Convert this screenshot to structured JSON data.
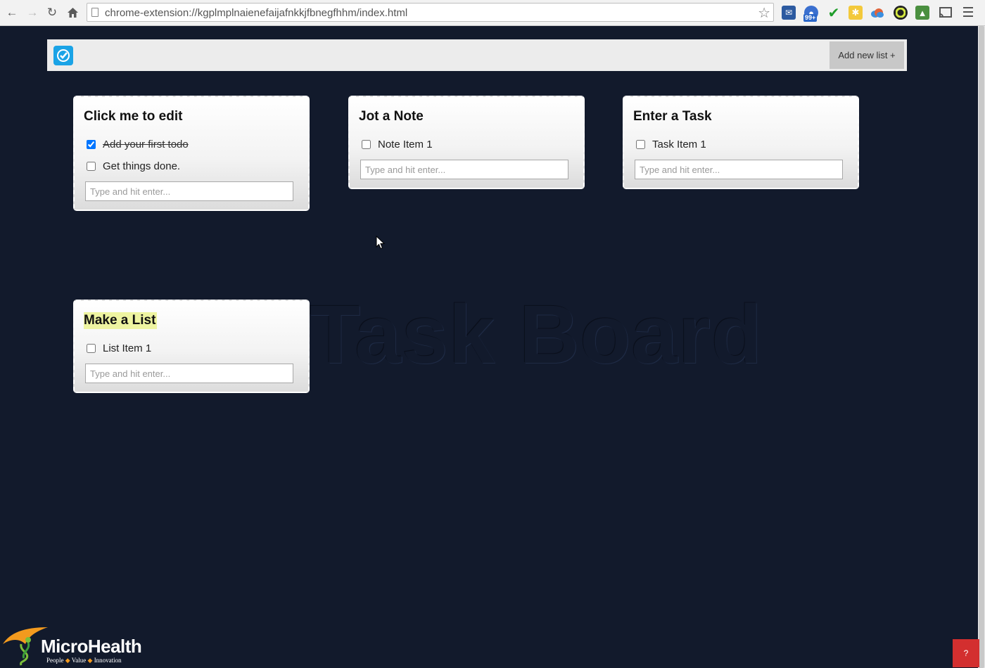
{
  "browser": {
    "url": "chrome-extension://kgplmplnaienefaijafnkkjfbnegfhhm/index.html",
    "extension_badge": "99+"
  },
  "header": {
    "add_list_label": "Add new list +"
  },
  "watermark": "Task Board",
  "lists": [
    {
      "title": "Click me to edit",
      "items": [
        {
          "label": "Add your first todo",
          "checked": true
        },
        {
          "label": "Get things done.",
          "checked": false
        }
      ],
      "input_placeholder": "Type and hit enter..."
    },
    {
      "title": "Jot a Note",
      "items": [
        {
          "label": "Note Item 1",
          "checked": false
        }
      ],
      "input_placeholder": "Type and hit enter..."
    },
    {
      "title": "Enter a Task",
      "items": [
        {
          "label": "Task Item 1",
          "checked": false
        }
      ],
      "input_placeholder": "Type and hit enter..."
    },
    {
      "title": "Make a List",
      "items": [
        {
          "label": "List Item 1",
          "checked": false
        }
      ],
      "input_placeholder": "Type and hit enter..."
    }
  ],
  "footer": {
    "brand_name": "MicroHealth",
    "tagline": [
      "People",
      "Value",
      "Innovation"
    ],
    "help_label": "?"
  },
  "colors": {
    "background": "#121a2c",
    "logo_blue": "#1aa3e6",
    "help_red": "#d32f2f",
    "title_highlight": "#eef4a1"
  }
}
